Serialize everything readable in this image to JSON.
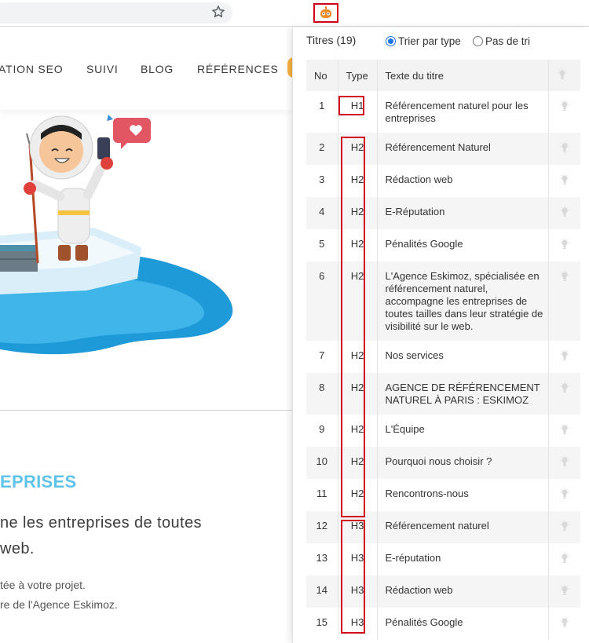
{
  "site": {
    "nav": [
      "ATION SEO",
      "SUIVI",
      "BLOG",
      "RÉFÉRENCES"
    ],
    "heading": "EPRISES",
    "lead_lines": [
      "ne les entreprises de toutes",
      "web."
    ],
    "small_lines": [
      "tée à votre projet.",
      "re de l'Agence Eskimoz."
    ]
  },
  "panel": {
    "title": "Titres (19)",
    "sort_by_type_label": "Trier par type",
    "no_sort_label": "Pas de tri",
    "columns": {
      "no": "No",
      "type": "Type",
      "text": "Texte du titre"
    },
    "rows": [
      {
        "no": "1",
        "type": "H1",
        "text": "Référencement naturel pour les entreprises"
      },
      {
        "no": "2",
        "type": "H2",
        "text": "Référencement Naturel"
      },
      {
        "no": "3",
        "type": "H2",
        "text": "Rédaction web"
      },
      {
        "no": "4",
        "type": "H2",
        "text": "E-Réputation"
      },
      {
        "no": "5",
        "type": "H2",
        "text": "Pénalités Google"
      },
      {
        "no": "6",
        "type": "H2",
        "text": "L'Agence Eskimoz, spécialisée en référencement naturel, accompagne les entreprises de toutes tailles dans leur stratégie de visibilité sur le web."
      },
      {
        "no": "7",
        "type": "H2",
        "text": "Nos services"
      },
      {
        "no": "8",
        "type": "H2",
        "text": "AGENCE DE RÉFÉRENCEMENT NATUREL À PARIS : ESKIMOZ"
      },
      {
        "no": "9",
        "type": "H2",
        "text": "L'Équipe"
      },
      {
        "no": "10",
        "type": "H2",
        "text": "Pourquoi nous choisir ?"
      },
      {
        "no": "11",
        "type": "H2",
        "text": "Rencontrons-nous"
      },
      {
        "no": "12",
        "type": "H3",
        "text": "Référencement naturel"
      },
      {
        "no": "13",
        "type": "H3",
        "text": "E-réputation"
      },
      {
        "no": "14",
        "type": "H3",
        "text": "Rédaction web"
      },
      {
        "no": "15",
        "type": "H3",
        "text": "Pénalités Google"
      }
    ]
  },
  "colors": {
    "highlight": "#d0021b",
    "accent_blue": "#1a73e8",
    "heading_blue": "#5fc2e8"
  }
}
